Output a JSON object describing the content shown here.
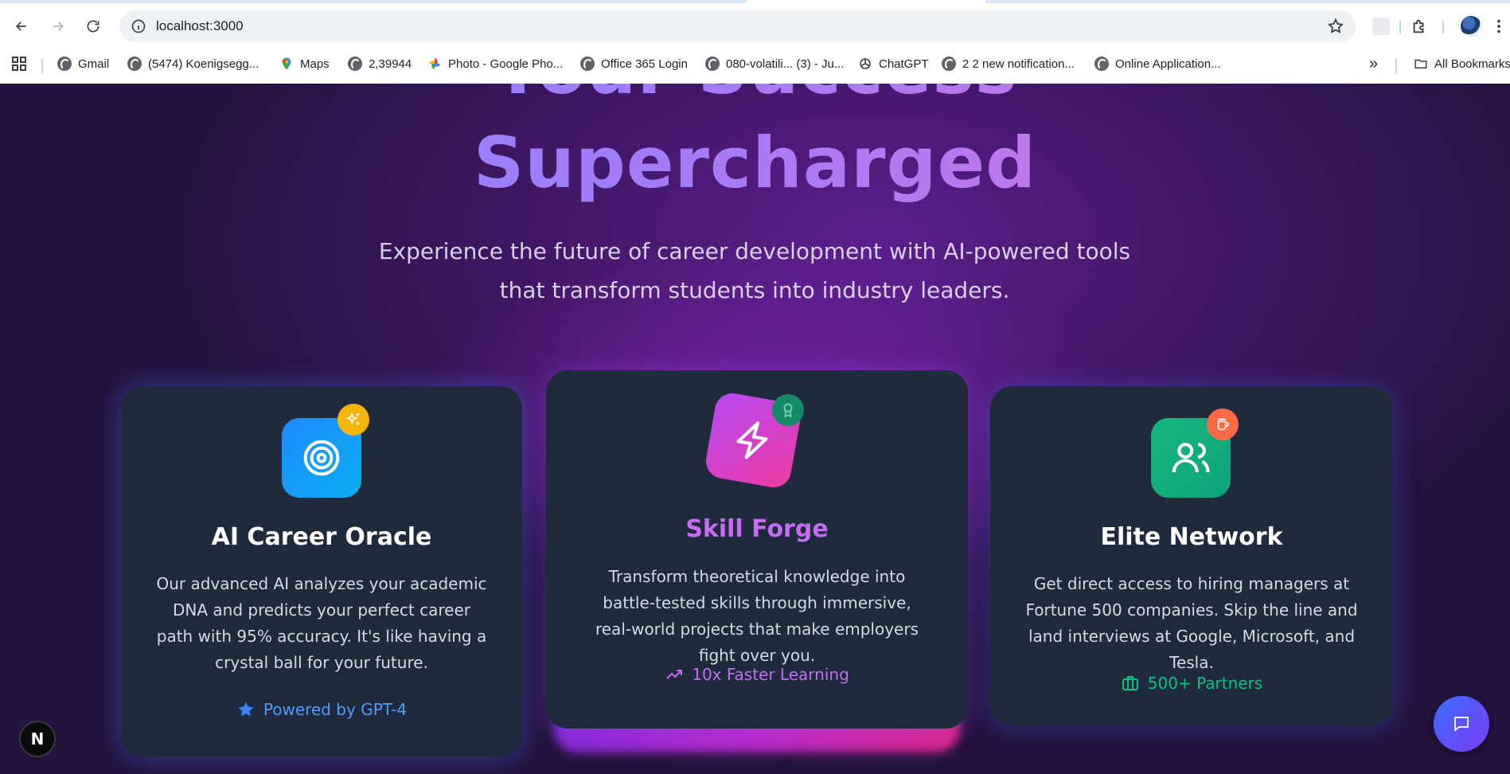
{
  "browser": {
    "url": "localhost:3000",
    "bookmarks": [
      {
        "label": "Gmail",
        "icon": "globe-icon"
      },
      {
        "label": "(5474) Koenigsegg...",
        "icon": "globe-icon"
      },
      {
        "label": "Maps",
        "icon": "maps-pin-icon"
      },
      {
        "label": "2,39944",
        "icon": "globe-icon"
      },
      {
        "label": "Photo - Google Pho...",
        "icon": "google-photos-icon"
      },
      {
        "label": "Office 365 Login",
        "icon": "globe-icon"
      },
      {
        "label": "080-volatili... (3) - Ju...",
        "icon": "globe-icon"
      },
      {
        "label": "ChatGPT",
        "icon": "chatgpt-icon"
      },
      {
        "label": "2 2 new notification...",
        "icon": "globe-icon"
      },
      {
        "label": "Online Application...",
        "icon": "globe-icon"
      }
    ],
    "more_label": "»",
    "all_bookmarks_label": "All Bookmarks"
  },
  "hero": {
    "line1": "Your Success",
    "line2": "Supercharged",
    "subtitle": "Experience the future of career development with AI-powered tools that transform students into industry leaders."
  },
  "cards": [
    {
      "title": "AI Career Oracle",
      "description": "Our advanced AI analyzes your academic DNA and predicts your perfect career path with 95% accuracy. It's like having a crystal ball for your future.",
      "footer": "Powered by GPT-4",
      "icon": "target-icon",
      "badge_icon": "sparkles-icon",
      "accent": "#3b82f6"
    },
    {
      "title": "Skill Forge",
      "description": "Transform theoretical knowledge into battle-tested skills through immersive, real-world projects that make employers fight over you.",
      "footer": "10x Faster Learning",
      "icon": "lightning-icon",
      "badge_icon": "award-icon",
      "accent": "#c084fc"
    },
    {
      "title": "Elite Network",
      "description": "Get direct access to hiring managers at Fortune 500 companies. Skip the line and land interviews at Google, Microsoft, and Tesla.",
      "footer": "500+ Partners",
      "icon": "users-icon",
      "badge_icon": "coffee-icon",
      "accent": "#10b981"
    }
  ],
  "next_badge": "N"
}
